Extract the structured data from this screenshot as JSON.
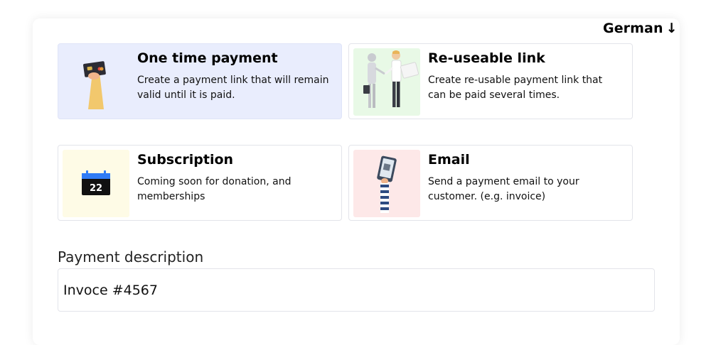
{
  "language": {
    "label": "German",
    "arrow": "↓"
  },
  "options": [
    {
      "title": "One time payment",
      "description": "Create a payment link that will remain valid until it is paid.",
      "icon": "credit-card-hand-icon",
      "selected": true
    },
    {
      "title": "Re-useable link",
      "description": "Create re-usable payment link that can be paid several times.",
      "icon": "handshake-robot-icon",
      "selected": false
    },
    {
      "title": "Subscription",
      "description": "Coming soon for donation, and memberships",
      "icon": "calendar-icon",
      "calendar_day": "22",
      "selected": false
    },
    {
      "title": "Email",
      "description": "Send a payment email to your customer. (e.g. invoice)",
      "icon": "phone-hand-icon",
      "selected": false
    }
  ],
  "payment_description": {
    "label": "Payment description",
    "value": "Invoce #4567"
  },
  "colors": {
    "selected_card_bg": "#e9edfd",
    "card_border": "#e3e4ea",
    "reuse_thumb_bg": "#e8f9e6",
    "subscription_thumb_bg": "#fefbe6",
    "email_thumb_bg": "#fde8e8",
    "calendar_blue": "#2f7cf6"
  }
}
